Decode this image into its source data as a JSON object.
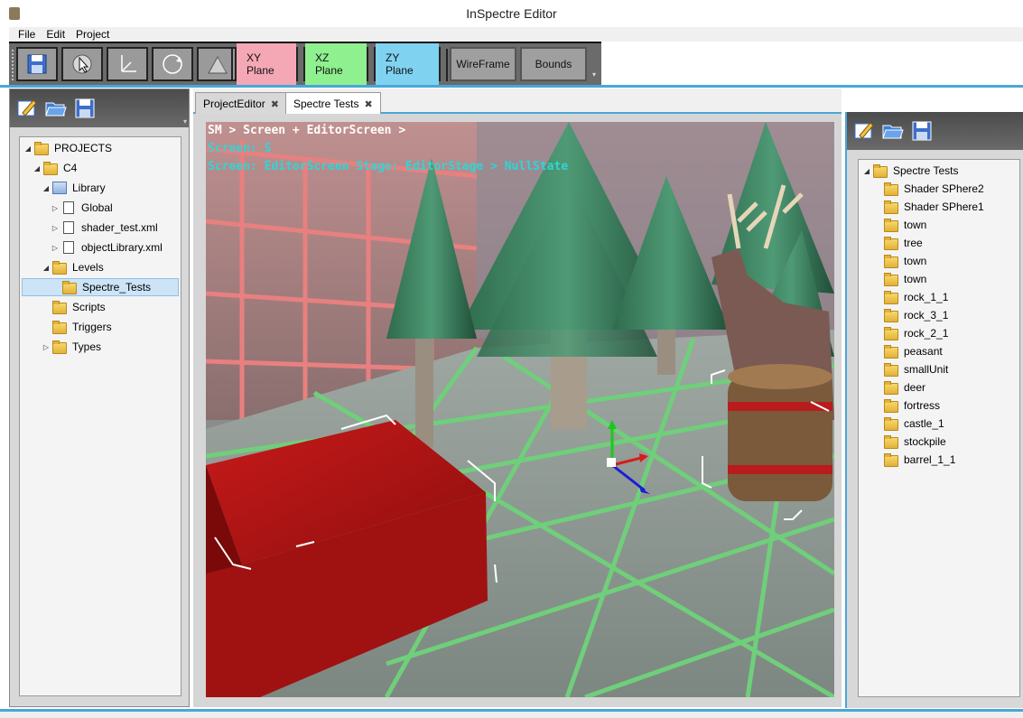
{
  "window": {
    "title": "InSpectre Editor"
  },
  "menu": [
    "File",
    "Edit",
    "Project"
  ],
  "toolbar": {
    "icon_buttons": [
      "save-icon",
      "select-pointer-icon",
      "axis-move-icon",
      "rotate-icon",
      "scale-icon"
    ],
    "plane_buttons": [
      {
        "label": "XY Plane",
        "color": "#f4a7b4"
      },
      {
        "label": "XZ Plane",
        "color": "#8ef08e"
      },
      {
        "label": "ZY Plane",
        "color": "#7fd2f0"
      }
    ],
    "view_buttons": [
      "WireFrame",
      "Bounds"
    ]
  },
  "left_panel": {
    "toolbar_icons": [
      "edit-icon",
      "open-folder-icon",
      "save-icon"
    ],
    "tree": [
      {
        "label": "PROJECTS",
        "depth": 0,
        "expanded": true,
        "icon": "folder"
      },
      {
        "label": "C4",
        "depth": 1,
        "expanded": true,
        "icon": "folder"
      },
      {
        "label": "Library",
        "depth": 2,
        "expanded": true,
        "icon": "library"
      },
      {
        "label": "Global",
        "depth": 3,
        "expanded": false,
        "icon": "doc"
      },
      {
        "label": "shader_test.xml",
        "depth": 3,
        "expanded": false,
        "icon": "doc"
      },
      {
        "label": "objectLibrary.xml",
        "depth": 3,
        "expanded": false,
        "icon": "doc"
      },
      {
        "label": "Levels",
        "depth": 2,
        "expanded": true,
        "icon": "folder"
      },
      {
        "label": "Spectre_Tests",
        "depth": 3,
        "selected": true,
        "icon": "folder"
      },
      {
        "label": "Scripts",
        "depth": 2,
        "icon": "folder"
      },
      {
        "label": "Triggers",
        "depth": 2,
        "icon": "folder"
      },
      {
        "label": "Types",
        "depth": 2,
        "expanded": false,
        "icon": "folder"
      }
    ]
  },
  "tabs": [
    {
      "label": "ProjectEditor",
      "active": false
    },
    {
      "label": "Spectre Tests",
      "active": true
    }
  ],
  "viewport": {
    "overlay": [
      "SM > Screen + EditorScreen >",
      "Screen: S",
      "Screen: EditorScreen Stage: EditorStage > NullState"
    ]
  },
  "right_panel": {
    "toolbar_icons": [
      "edit-icon",
      "open-folder-icon",
      "save-icon"
    ],
    "root": "Spectre Tests",
    "items": [
      "Shader SPhere2",
      "Shader SPhere1",
      "town",
      "tree",
      "town",
      "town",
      "rock_1_1",
      "rock_3_1",
      "rock_2_1",
      "peasant",
      "smallUnit",
      "deer",
      "fortress",
      "castle_1",
      "stockpile",
      "barrel_1_1"
    ]
  }
}
